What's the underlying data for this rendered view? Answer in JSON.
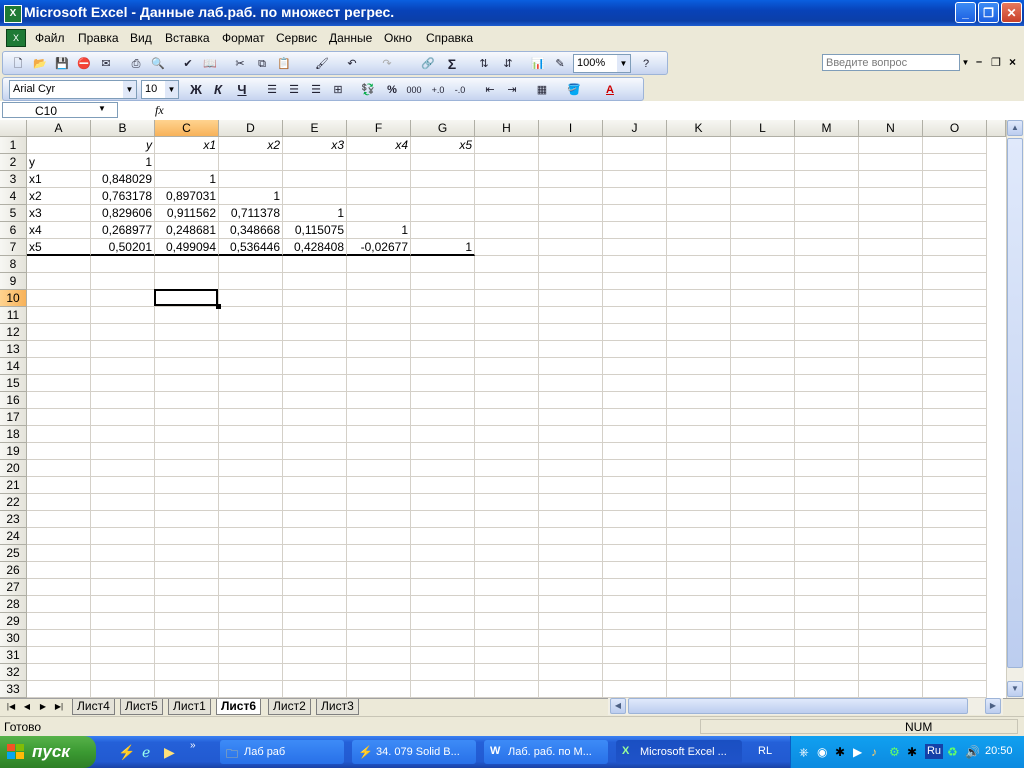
{
  "window": {
    "title": "Microsoft Excel - Данные лаб.раб. по множест регрес.",
    "controls": {
      "minimize": "_",
      "restore": "❐",
      "close": "✕"
    }
  },
  "menu": {
    "items": [
      "Файл",
      "Правка",
      "Вид",
      "Вставка",
      "Формат",
      "Сервис",
      "Данные",
      "Окно",
      "Справка"
    ],
    "ask_placeholder": "Введите вопрос"
  },
  "toolbar": {
    "zoom": "100%",
    "font_name": "Arial Cyr",
    "font_size": "10",
    "bold": "Ж",
    "italic": "К",
    "underline": "Ч",
    "percent": "%",
    "thousands": "000",
    "sum": "Σ"
  },
  "formula_bar": {
    "name_box": "C10",
    "fx": "fx",
    "content": ""
  },
  "grid": {
    "columns": [
      "A",
      "B",
      "C",
      "D",
      "E",
      "F",
      "G",
      "H",
      "I",
      "J",
      "K",
      "L",
      "M",
      "N",
      "O"
    ],
    "selected_column": "C",
    "selected_row": "10",
    "rows_count": 33,
    "table": {
      "header": [
        "",
        "y",
        "x1",
        "x2",
        "x3",
        "x4",
        "x5"
      ],
      "rows": [
        [
          "y",
          "1",
          "",
          "",
          "",
          "",
          ""
        ],
        [
          "x1",
          "0,848029",
          "1",
          "",
          "",
          "",
          ""
        ],
        [
          "x2",
          "0,763178",
          "0,897031",
          "1",
          "",
          "",
          ""
        ],
        [
          "x3",
          "0,829606",
          "0,911562",
          "0,711378",
          "1",
          "",
          ""
        ],
        [
          "x4",
          "0,268977",
          "0,248681",
          "0,348668",
          "0,115075",
          "1",
          ""
        ],
        [
          "x5",
          "0,50201",
          "0,499094",
          "0,536446",
          "0,428408",
          "-0,02677",
          "1"
        ]
      ]
    }
  },
  "sheets": {
    "tabs": [
      "Лист4",
      "Лист5",
      "Лист1",
      "Лист6",
      "Лист2",
      "Лист3"
    ],
    "active": "Лист6"
  },
  "status": {
    "ready": "Готово",
    "num": "NUM"
  },
  "taskbar": {
    "start": "пуск",
    "tasks": [
      {
        "label": "Лаб раб",
        "active": false
      },
      {
        "label": "34. 079 Solid B...",
        "active": false
      },
      {
        "label": "Лаб. раб. по М...",
        "active": false
      },
      {
        "label": "Microsoft Excel ...",
        "active": true
      }
    ],
    "lang": "RL",
    "tray_lang": "Ru",
    "clock": "20:50"
  },
  "colors": {
    "accent_selected_header": "#f7b25a",
    "taskbar": "#225ad1",
    "start": "#3b9a32"
  }
}
